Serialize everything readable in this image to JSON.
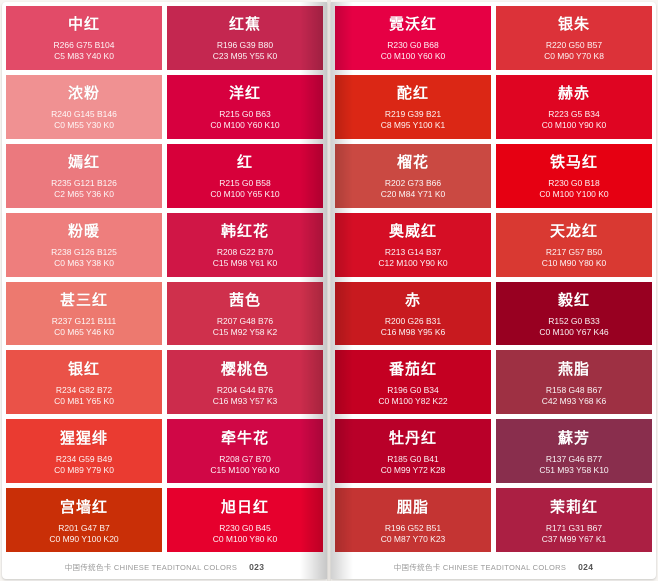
{
  "pages": [
    {
      "footer": {
        "label": "中国传统色卡 CHINESE TEADITONAL COLORS",
        "number": "023"
      },
      "swatches": [
        {
          "name": "中红",
          "rgb": "R266 G75 B104",
          "cmyk": "C5 M83 Y40 K0",
          "color": "#e24b68"
        },
        {
          "name": "红蕉",
          "rgb": "R196 G39 B80",
          "cmyk": "C23 M95 Y55 K0",
          "color": "#c42750"
        },
        {
          "name": "浓粉",
          "rgb": "R240 G145 B146",
          "cmyk": "C0 M55 Y30 K0",
          "color": "#f09192"
        },
        {
          "name": "洋红",
          "rgb": "R215 G0 B63",
          "cmyk": "C0 M100 Y60 K10",
          "color": "#d7003f"
        },
        {
          "name": "嫣红",
          "rgb": "R235 G121 B126",
          "cmyk": "C2 M65 Y36 K0",
          "color": "#eb797e"
        },
        {
          "name": "红",
          "rgb": "R215 G0 B58",
          "cmyk": "C0 M100 Y65 K10",
          "color": "#d7003a"
        },
        {
          "name": "粉暖",
          "rgb": "R238 G126 B125",
          "cmyk": "C0 M63 Y38 K0",
          "color": "#ee7e7d"
        },
        {
          "name": "韩红花",
          "rgb": "R208 G22 B70",
          "cmyk": "C15 M98 Y61 K0",
          "color": "#d01646"
        },
        {
          "name": "甚三红",
          "rgb": "R237 G121 B111",
          "cmyk": "C0 M65 Y46 K0",
          "color": "#ed796f"
        },
        {
          "name": "茜色",
          "rgb": "R207 G48 B76",
          "cmyk": "C15 M92 Y58 K2",
          "color": "#cf304c"
        },
        {
          "name": "银红",
          "rgb": "R234 G82 B72",
          "cmyk": "C0 M81 Y65 K0",
          "color": "#ea5248"
        },
        {
          "name": "樱桃色",
          "rgb": "R204 G44 B76",
          "cmyk": "C16 M93 Y57 K3",
          "color": "#cc2c4c"
        },
        {
          "name": "猩猩绯",
          "rgb": "R234 G59 B49",
          "cmyk": "C0 M89 Y79 K0",
          "color": "#ea3b31"
        },
        {
          "name": "牵牛花",
          "rgb": "R208 G7 B70",
          "cmyk": "C15 M100 Y60 K0",
          "color": "#d00746"
        },
        {
          "name": "宫墙红",
          "rgb": "R201 G47 B7",
          "cmyk": "C0 M90 Y100 K20",
          "color": "#c92f07"
        },
        {
          "name": "旭日红",
          "rgb": "R230 G0 B45",
          "cmyk": "C0 M100 Y80 K0",
          "color": "#e6002d"
        }
      ]
    },
    {
      "footer": {
        "label": "中国传统色卡 CHINESE TEADITONAL COLORS",
        "number": "024"
      },
      "swatches": [
        {
          "name": "霓沃红",
          "rgb": "R230 G0 B68",
          "cmyk": "C0 M100 Y60 K0",
          "color": "#e60044"
        },
        {
          "name": "银朱",
          "rgb": "R220 G50 B57",
          "cmyk": "C0 M90 Y70 K8",
          "color": "#dc3239"
        },
        {
          "name": "酡红",
          "rgb": "R219 G39 B21",
          "cmyk": "C8 M95 Y100 K1",
          "color": "#db2715"
        },
        {
          "name": "赫赤",
          "rgb": "R223 G5 B34",
          "cmyk": "C0 M100 Y90 K0",
          "color": "#df0522"
        },
        {
          "name": "榴花",
          "rgb": "R202 G73 B66",
          "cmyk": "C20 M84 Y71 K0",
          "color": "#ca4942"
        },
        {
          "name": "铁马红",
          "rgb": "R230 G0 B18",
          "cmyk": "C0 M100 Y100 K0",
          "color": "#e60012"
        },
        {
          "name": "奥威红",
          "rgb": "R213 G14 B37",
          "cmyk": "C12 M100 Y90 K0",
          "color": "#d50e25"
        },
        {
          "name": "天龙红",
          "rgb": "R217 G57 B50",
          "cmyk": "C10 M90 Y80 K0",
          "color": "#d93932"
        },
        {
          "name": "赤",
          "rgb": "R200 G26 B31",
          "cmyk": "C16 M98 Y95 K6",
          "color": "#c81a1f"
        },
        {
          "name": "毅红",
          "rgb": "R152 G0 B33",
          "cmyk": "C0 M100 Y67 K46",
          "color": "#980021"
        },
        {
          "name": "番茄红",
          "rgb": "R196 G0 B34",
          "cmyk": "C0 M100 Y82 K22",
          "color": "#c40022"
        },
        {
          "name": "燕脂",
          "rgb": "R158 G48 B67",
          "cmyk": "C42 M93 Y68 K6",
          "color": "#9e3043"
        },
        {
          "name": "牡丹红",
          "rgb": "R185 G0 B41",
          "cmyk": "C0 M99 Y72 K28",
          "color": "#b90029"
        },
        {
          "name": "蘇芳",
          "rgb": "R137 G46 B77",
          "cmyk": "C51 M93 Y58 K10",
          "color": "#892e4d"
        },
        {
          "name": "胭脂",
          "rgb": "R196 G52 B51",
          "cmyk": "C0 M87 Y70 K23",
          "color": "#c43433"
        },
        {
          "name": "茉莉红",
          "rgb": "R171 G31 B67",
          "cmyk": "C37 M99 Y67 K1",
          "color": "#ab1f43"
        }
      ]
    }
  ]
}
